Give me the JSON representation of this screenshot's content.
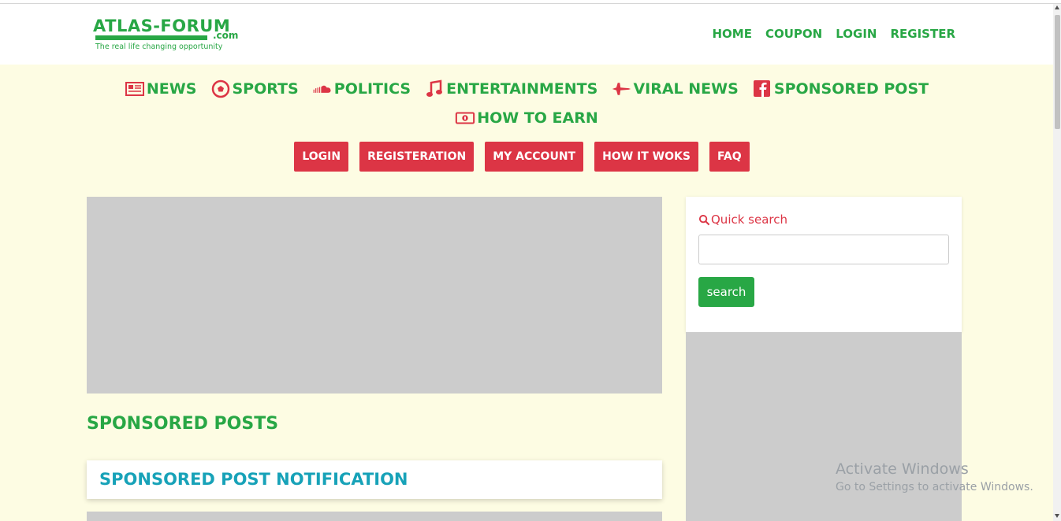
{
  "logo": {
    "name": "ATLAS-FORUM",
    "domain": ".com",
    "tagline": "The real life changing opportunity"
  },
  "top_nav": [
    "HOME",
    "COUPON",
    "LOGIN",
    "REGISTER"
  ],
  "categories": [
    {
      "label": "NEWS",
      "icon": "newspaper-icon"
    },
    {
      "label": "SPORTS",
      "icon": "soccer-ball-icon"
    },
    {
      "label": "POLITICS",
      "icon": "soundcloud-icon"
    },
    {
      "label": "ENTERTAINMENTS",
      "icon": "music-note-icon"
    },
    {
      "label": "VIRAL NEWS",
      "icon": "fighter-jet-icon"
    },
    {
      "label": "SPONSORED POST",
      "icon": "facebook-icon"
    },
    {
      "label": "HOW TO EARN",
      "icon": "money-bill-icon"
    }
  ],
  "action_buttons": [
    "LOGIN",
    "REGISTERATION",
    "MY ACCOUNT",
    "HOW IT WOKS",
    "FAQ"
  ],
  "main": {
    "sponsored_heading": "SPONSORED POSTS",
    "notification_title": "SPONSORED POST NOTIFICATION"
  },
  "sidebar": {
    "search_label": "Quick search",
    "search_value": "",
    "search_button": "search"
  },
  "watermark": {
    "line1": "Activate Windows",
    "line2": "Go to Settings to activate Windows."
  },
  "colors": {
    "green": "#28a745",
    "red": "#dc3545",
    "teal": "#17a2b8",
    "page_bg": "#fdfce3",
    "placeholder_gray": "#cccccc"
  }
}
